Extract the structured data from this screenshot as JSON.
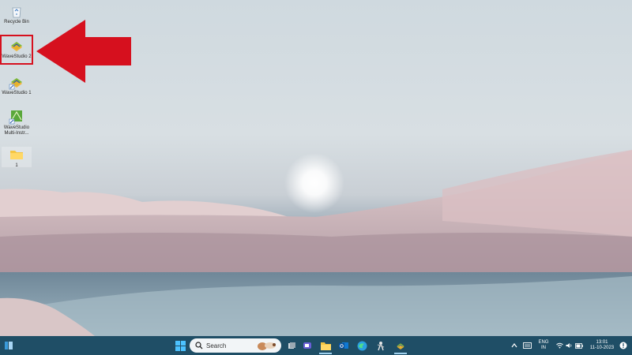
{
  "desktop_icons": [
    {
      "id": "recycle-bin",
      "label": "Recycle Bin"
    },
    {
      "id": "wavestudio-2",
      "label": "WaveStudio 2"
    },
    {
      "id": "wavestudio-1",
      "label": "WaveStudio 1"
    },
    {
      "id": "wavestudio-multi",
      "label": "WaveStudio Multi-Instr..."
    },
    {
      "id": "folder-1",
      "label": "1"
    }
  ],
  "taskbar": {
    "search_placeholder": "Search",
    "language": "ENG",
    "region": "IN",
    "time": "13:01",
    "date": "11-10-2023"
  },
  "colors": {
    "highlight": "#d6101e",
    "taskbar": "#1f4e66"
  }
}
